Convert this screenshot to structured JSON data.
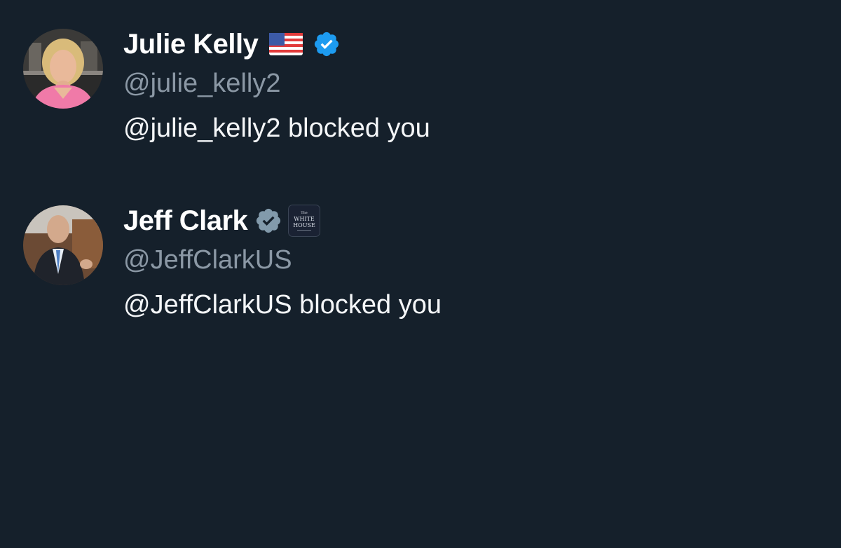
{
  "theme": {
    "background": "#15202b",
    "name_color": "#ffffff",
    "handle_color": "#8b98a5",
    "message_color": "#f4f6f8",
    "verified_blue": "#1d9bf0",
    "verified_gray": "#829aab"
  },
  "notifications": [
    {
      "display_name": "Julie Kelly",
      "flag_icon": "us-flag-icon",
      "badge_icon": "verified-blue-icon",
      "handle": "@julie_kelly2",
      "message": "@julie_kelly2 blocked you"
    },
    {
      "display_name": "Jeff Clark",
      "badge_icon": "verified-gray-icon",
      "affiliation_icon": "white-house-icon",
      "affiliation_text": [
        "The",
        "WHITE",
        "HOUSE"
      ],
      "handle": "@JeffClarkUS",
      "message": "@JeffClarkUS blocked you"
    }
  ]
}
